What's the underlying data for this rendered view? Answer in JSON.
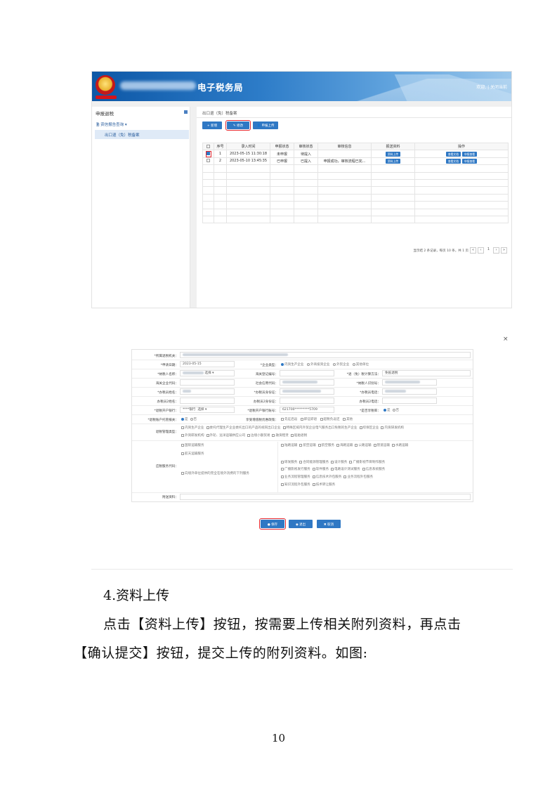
{
  "header": {
    "site_name": "电子税务局",
    "links": "欢迎,  |  关闭当前"
  },
  "sidebar": {
    "title": "申报退税",
    "group": "资信报告查询 ▾",
    "item": "出口退（免）税备案"
  },
  "content": {
    "breadcrumb": "出口退（免）税备案",
    "toolbar": {
      "add": "+ 新增",
      "edit": "修改",
      "upload": "申报上传"
    },
    "columns": [
      "序号",
      "录入时间",
      "申报状态",
      "审核状态",
      "审核信息",
      "报送资料",
      "操作"
    ],
    "rows": [
      {
        "checked": true,
        "no": "1",
        "time": "2023-05-15 11:30:18",
        "declare": "未申报",
        "review": "待提入",
        "info": "",
        "upload_btn": "资料上传",
        "op1": "查看文档",
        "op2": "申报查看"
      },
      {
        "checked": false,
        "no": "2",
        "time": "2023-05-10 13:45:35",
        "declare": "已申报",
        "review": "已提入",
        "info": "申报成功，审核流程已完...",
        "upload_btn": "资料上传",
        "op1": "查看文档",
        "op2": "申报查看"
      }
    ],
    "pager": {
      "summary": "显示结 2 条记录，每页 10 条，共 1 页",
      "current": "1"
    }
  },
  "form": {
    "close": "×",
    "labels": {
      "tax_office": "*所属退税机关：",
      "apply_date": "*申请日期：",
      "enterprise_type": "*企业类型：",
      "tax_name": "*纳税人名称：",
      "customs_code": "海关登记编号：",
      "refund_method": "*退（免）税计算方法：",
      "biz_code": "海关企业代码：",
      "credit_code": "社会信用代码：",
      "taxpayer_id": "*纳税人识别号：",
      "contact_name": "*办税员姓名：",
      "contact_id": "*办税员身份证：",
      "contact_phone": "*办税员电话：",
      "contact2_name": "办税员2姓名：",
      "contact2_id": "办税员2身份证：",
      "contact2_phone": "办税员2电话：",
      "bank": "*退税开户银行：",
      "bank_account": "*退税开户银行账号：",
      "ignore_no": "*是否享税率：",
      "is_account": "*退税账户托管报关：",
      "exemption": "享受增值税优惠政策：",
      "refund_mgmt": "退税管理类型：",
      "service_code": "应税服务代码：",
      "remark": "附送资料："
    },
    "values": {
      "apply_date": "2023-05-15",
      "refund_method": "免抵退税",
      "bank": "****银行",
      "bank_account": "621700*********5709",
      "select_label": "选择"
    },
    "enterprise_types": [
      "内资生产企业",
      "外商投资企业",
      "外贸企业",
      "其他单位"
    ],
    "yes": "是",
    "no": "否",
    "exemption_opts": [
      "先征后返",
      "即征即退",
      "超税负返还",
      "其他"
    ],
    "mgmt_opts_1": [
      "内资生产企业",
      "委托代理生产企业委托出口的产品的视同出口企业",
      "特殊区域内外贸企业电气服务出口免税的生产企业",
      "综保区企业",
      "内资研发机构"
    ],
    "mgmt_opts_2": [
      "外资研发机构",
      "外轮、远洋运输供应公司",
      "边境小额贸易",
      "融资租赁",
      "船舶退税"
    ],
    "svc_left": [
      "国际运输服务",
      "航天运输服务",
      "向境外单位提供的完全在境外消费的下列服务"
    ],
    "svc_top": [
      "陆路运输",
      "航空运输",
      "航空服务",
      "海路运输",
      "公路运输",
      "管道运输",
      "水路运输"
    ],
    "svc_grid": [
      [
        "研发服务",
        "合同能源管理服务",
        "设计服务",
        "广播影视节目制作服务"
      ],
      [
        "广播影视发行服务",
        "软件服务",
        "电路设计测试服务",
        "信息系统服务"
      ],
      [
        "业务流程管理服务",
        "信息技术外包服务",
        "业务流程外包服务"
      ],
      [
        "知识流程外包服务",
        "技术转让服务"
      ]
    ],
    "buttons": {
      "save": "保存",
      "cancel": "退出",
      "close": "取消"
    }
  },
  "doc": {
    "section": "4.资料上传",
    "para1": "点击【资料上传】按钮，按需要上传相关附列资料，再点击",
    "para2": "【确认提交】按钮，提交上传的附列资料。如图:",
    "page": "10"
  },
  "colors": {
    "brand_blue": "#2f78c4",
    "highlight_red": "#e3262e",
    "banner_blue": "#0d57a6"
  }
}
